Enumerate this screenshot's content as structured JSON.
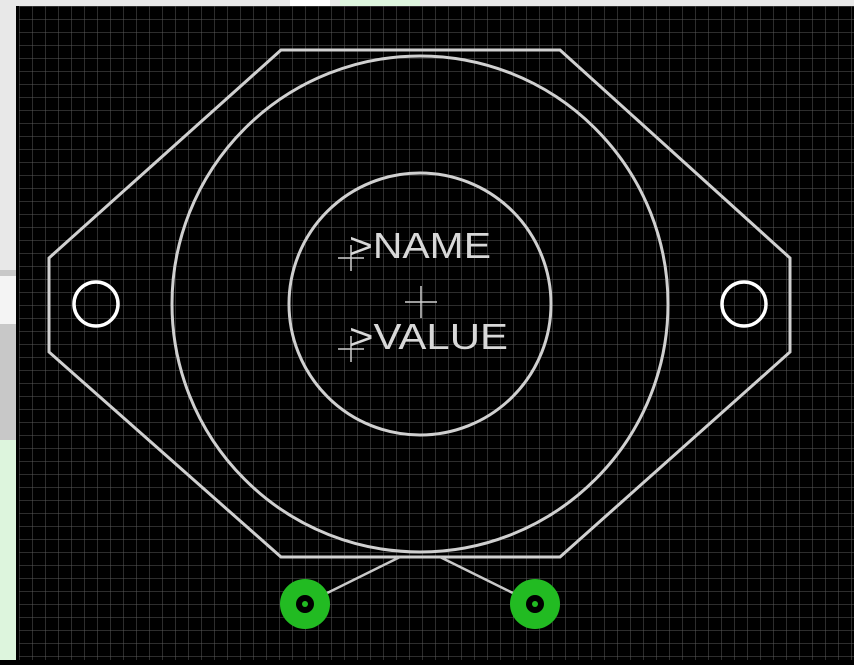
{
  "editor": {
    "background_color": "#000000",
    "grid_color": "#5a5a5a",
    "silkscreen_color": "#d0d0d0",
    "pad_color": "#22bb22",
    "background_window_color": "#ddf5dd"
  },
  "footprint": {
    "name_placeholder": ">NAME",
    "value_placeholder": ">VALUE"
  },
  "icons": {
    "origin_marker": "crosshair-icon"
  }
}
